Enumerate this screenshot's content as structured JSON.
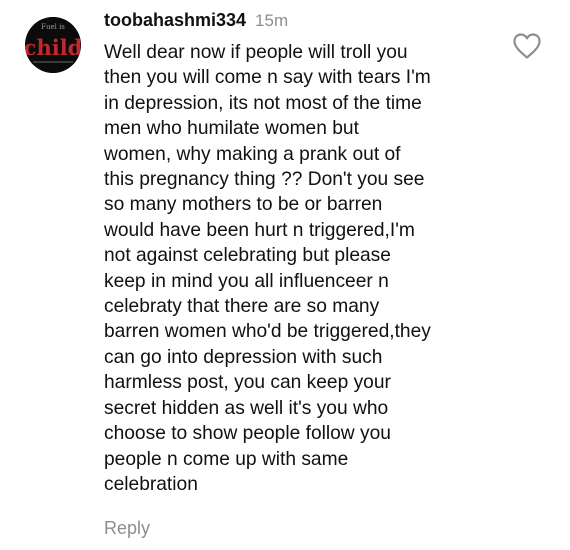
{
  "comment": {
    "username": "toobahashmi334",
    "timestamp": "15m",
    "text_lines": [
      "Well dear now if people will troll you",
      "then you will come n say with tears I'm",
      "in depression, its not most of the time",
      "men who humilate women but",
      "women, why making a prank out of",
      "this pregnancy thing ?? Don't you see",
      "so many mothers to be or barren",
      "would have been hurt n triggered,I'm",
      "not against celebrating but please",
      "keep in mind you all influenceer n",
      "celebraty that there are so many",
      "barren women who'd be triggered,they",
      "can go into depression with such",
      "harmless post, you can keep your",
      "secret hidden as well it's you who",
      "choose to show people follow you",
      "people n come up with same",
      "celebration"
    ],
    "avatar": {
      "logo_text": "child",
      "caption_text": "Fuel is"
    },
    "like_icon": "heart-outline-icon",
    "reply_label": "Reply"
  },
  "colors": {
    "text": "#111111",
    "muted": "#8e8e8e",
    "avatar_bg": "#0b0b0b",
    "avatar_logo": "#c0282c"
  }
}
